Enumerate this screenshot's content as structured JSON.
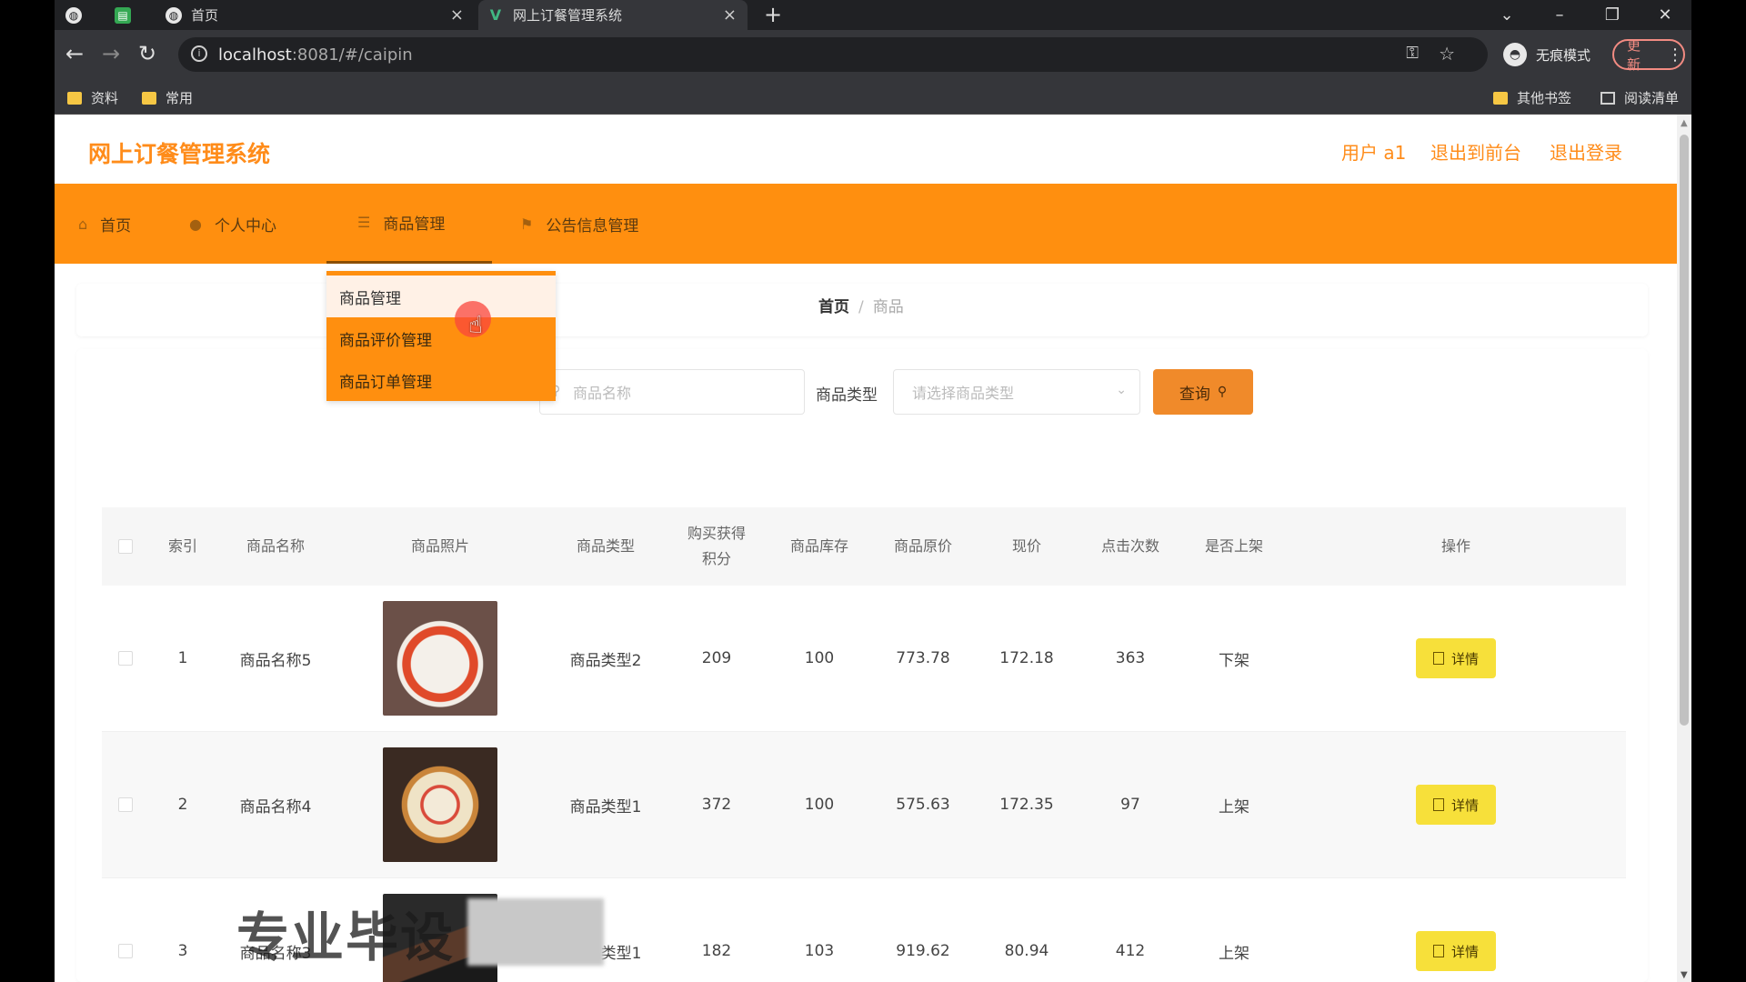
{
  "browser": {
    "tabs": [
      {
        "title": ""
      },
      {
        "title": ""
      },
      {
        "title": "首页"
      },
      {
        "title": "网上订餐管理系统"
      }
    ],
    "url_host": "localhost",
    "url_rest": ":8081/#/caipin",
    "incognito_label": "无痕模式",
    "update_label": "更新",
    "bookmarks": [
      "资料",
      "常用"
    ],
    "bookmarks_right": [
      "其他书签",
      "阅读清单"
    ]
  },
  "app": {
    "title": "网上订餐管理系统",
    "header_links": [
      "用户 a1",
      "退出到前台",
      "退出登录"
    ]
  },
  "menu": {
    "items": [
      "首页",
      "个人中心",
      "商品管理",
      "公告信息管理"
    ],
    "dropdown": [
      "商品管理",
      "商品评价管理",
      "商品订单管理"
    ]
  },
  "breadcrumb": {
    "home": "首页",
    "current": "商品"
  },
  "search": {
    "name_placeholder": "商品名称",
    "type_label": "商品类型",
    "type_placeholder": "请选择商品类型",
    "query_label": "查询"
  },
  "table": {
    "headers": [
      "索引",
      "商品名称",
      "商品照片",
      "商品类型",
      "购买获得积分",
      "商品库存",
      "商品原价",
      "现价",
      "点击次数",
      "是否上架",
      "操作"
    ],
    "rows": [
      {
        "index": "1",
        "name": "商品名称5",
        "type": "商品类型2",
        "points": "209",
        "stock": "100",
        "orig": "773.78",
        "price": "172.18",
        "clicks": "363",
        "status": "下架",
        "action": "详情"
      },
      {
        "index": "2",
        "name": "商品名称4",
        "type": "商品类型1",
        "points": "372",
        "stock": "100",
        "orig": "575.63",
        "price": "172.35",
        "clicks": "97",
        "status": "上架",
        "action": "详情"
      },
      {
        "index": "3",
        "name": "商品名称3",
        "type": "商品类型1",
        "points": "182",
        "stock": "103",
        "orig": "919.62",
        "price": "80.94",
        "clicks": "412",
        "status": "上架",
        "action": "详情"
      }
    ]
  },
  "overlay": {
    "watermark": "专业毕设"
  },
  "colors": {
    "accent": "#ff8f0f",
    "title": "#ff8c1a",
    "detail_button": "#f7e03a",
    "query_button": "#f08a2a"
  }
}
